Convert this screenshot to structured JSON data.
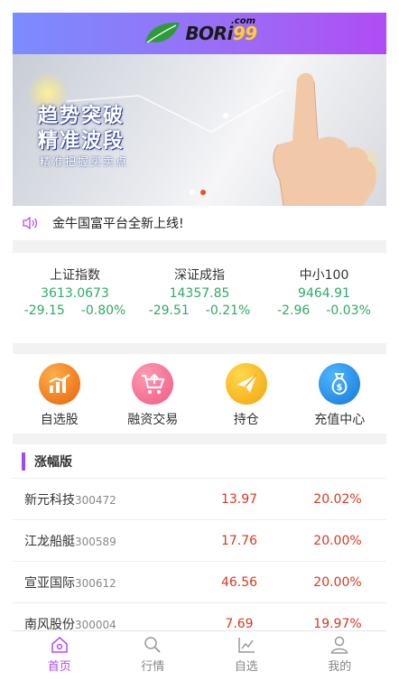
{
  "header": {
    "logo_text_main": "BORi",
    "logo_text_accent": "99",
    "logo_suffix": ".com"
  },
  "banner": {
    "headline_1": "趋势突破",
    "headline_2": "精准波段",
    "subline": "精准把握买卖点",
    "slides": 2,
    "active_slide": 2
  },
  "notice": {
    "text": "金牛国富平台全新上线!"
  },
  "indices": [
    {
      "name": "上证指数",
      "value": "3613.0673",
      "change": "-29.15",
      "percent": "-0.80%"
    },
    {
      "name": "深证成指",
      "value": "14357.85",
      "change": "-29.51",
      "percent": "-0.21%"
    },
    {
      "name": "中小100",
      "value": "9464.91",
      "change": "-2.96",
      "percent": "-0.03%"
    }
  ],
  "quick_actions": [
    {
      "label": "自选股",
      "icon": "bar-chart-icon",
      "color": "#f07a1a"
    },
    {
      "label": "融资交易",
      "icon": "cart-icon",
      "color": "#f06a8c"
    },
    {
      "label": "持仓",
      "icon": "paper-plane-icon",
      "color": "#f7b21b"
    },
    {
      "label": "充值中心",
      "icon": "money-bag-icon",
      "color": "#1e8ee8"
    }
  ],
  "rank": {
    "title": "涨幅版",
    "rows": [
      {
        "name": "新元科技",
        "code": "300472",
        "price": "13.97",
        "percent": "20.02%"
      },
      {
        "name": "江龙船艇",
        "code": "300589",
        "price": "17.76",
        "percent": "20.00%"
      },
      {
        "name": "宣亚国际",
        "code": "300612",
        "price": "46.56",
        "percent": "20.00%"
      },
      {
        "name": "南风股份",
        "code": "300004",
        "price": "7.69",
        "percent": "19.97%"
      }
    ]
  },
  "tabbar": [
    {
      "label": "首页",
      "icon": "home-icon",
      "active": true
    },
    {
      "label": "行情",
      "icon": "search-icon",
      "active": false
    },
    {
      "label": "自选",
      "icon": "line-chart-icon",
      "active": false
    },
    {
      "label": "我的",
      "icon": "user-icon",
      "active": false
    }
  ],
  "colors": {
    "accent": "#b04cf5",
    "up": "#d9381e",
    "down": "#2eaa6a"
  }
}
